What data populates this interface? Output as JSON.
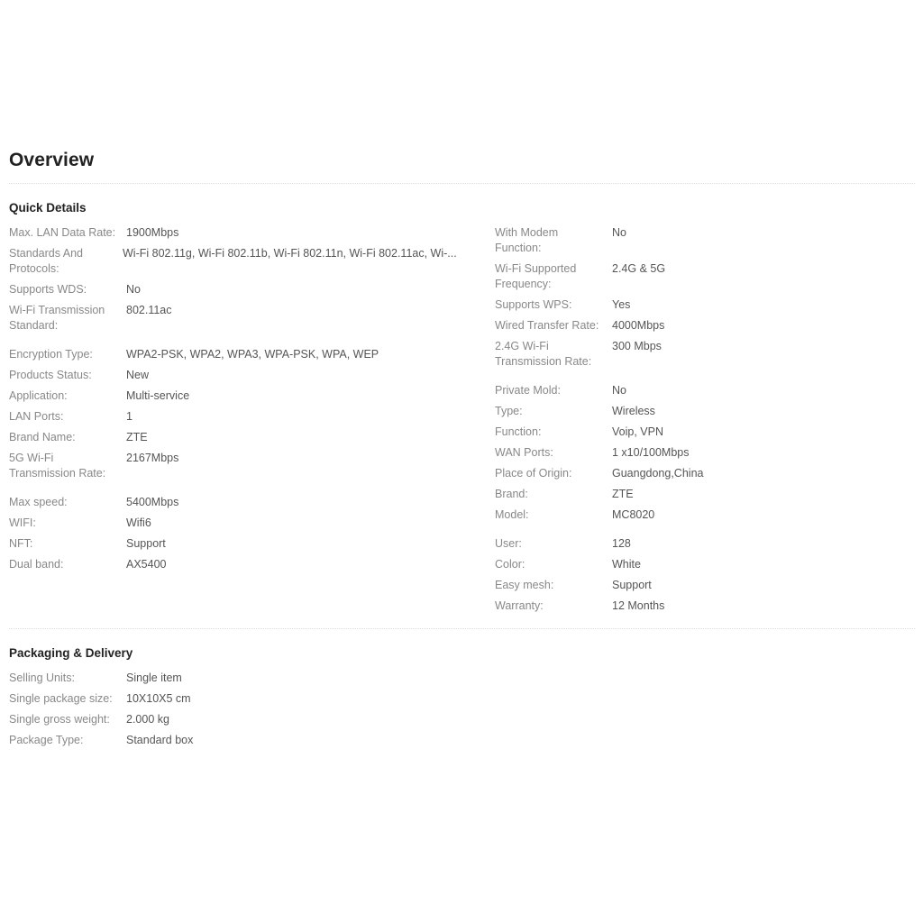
{
  "page": {
    "title": "Overview"
  },
  "quick_details": {
    "heading": "Quick Details",
    "left_groups": [
      {
        "rows": [
          {
            "label": "Max. LAN Data Rate:",
            "value": "1900Mbps"
          },
          {
            "label": "Standards And Protocols:",
            "value": "Wi-Fi 802.11g, Wi-Fi 802.11b, Wi-Fi 802.11n, Wi-Fi 802.11ac, Wi-..."
          },
          {
            "label": "Supports WDS:",
            "value": "No"
          },
          {
            "label": "Wi-Fi Transmission Standard:",
            "value": "802.11ac"
          }
        ]
      },
      {
        "rows": [
          {
            "label": "Encryption Type:",
            "value": "WPA2-PSK, WPA2, WPA3, WPA-PSK, WPA, WEP"
          },
          {
            "label": "Products Status:",
            "value": "New"
          },
          {
            "label": "Application:",
            "value": "Multi-service"
          },
          {
            "label": "LAN Ports:",
            "value": "1"
          },
          {
            "label": "Brand Name:",
            "value": "ZTE"
          },
          {
            "label": "5G Wi-Fi Transmission Rate:",
            "value": "2167Mbps"
          }
        ]
      },
      {
        "rows": [
          {
            "label": "Max speed:",
            "value": "5400Mbps"
          },
          {
            "label": "WIFI:",
            "value": "Wifi6"
          },
          {
            "label": "NFT:",
            "value": "Support"
          },
          {
            "label": "Dual band:",
            "value": "AX5400"
          }
        ]
      }
    ],
    "right_groups": [
      {
        "rows": [
          {
            "label": "With Modem Function:",
            "value": "No"
          },
          {
            "label": "Wi-Fi Supported Frequency:",
            "value": "2.4G & 5G"
          },
          {
            "label": "Supports WPS:",
            "value": "Yes"
          },
          {
            "label": "Wired Transfer Rate:",
            "value": "4000Mbps"
          },
          {
            "label": "2.4G Wi-Fi Transmission Rate:",
            "value": "300 Mbps"
          }
        ]
      },
      {
        "rows": [
          {
            "label": "Private Mold:",
            "value": "No"
          },
          {
            "label": "Type:",
            "value": "Wireless"
          },
          {
            "label": "Function:",
            "value": "Voip, VPN"
          },
          {
            "label": "WAN Ports:",
            "value": "1 x10/100Mbps"
          },
          {
            "label": "Place of Origin:",
            "value": "Guangdong,China"
          },
          {
            "label": "Brand:",
            "value": "ZTE"
          },
          {
            "label": "Model:",
            "value": "MC8020"
          }
        ]
      },
      {
        "rows": [
          {
            "label": "User:",
            "value": "128"
          },
          {
            "label": "Color:",
            "value": "White"
          },
          {
            "label": "Easy mesh:",
            "value": "Support"
          },
          {
            "label": "Warranty:",
            "value": "12 Months"
          }
        ]
      }
    ]
  },
  "packaging": {
    "heading": "Packaging & Delivery",
    "rows": [
      {
        "label": "Selling Units:",
        "value": "Single item"
      },
      {
        "label": "Single package size:",
        "value": "10X10X5 cm"
      },
      {
        "label": "Single gross weight:",
        "value": "2.000 kg"
      },
      {
        "label": "Package Type:",
        "value": "Standard box"
      }
    ]
  },
  "colors": {
    "heading_text": "#222222",
    "label_text": "#888888",
    "value_text": "#555555",
    "divider": "#dcdcdc",
    "background": "#ffffff"
  }
}
